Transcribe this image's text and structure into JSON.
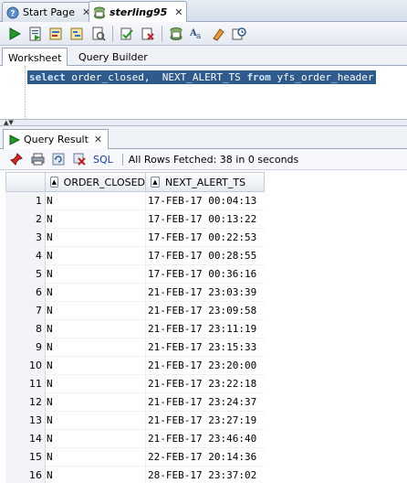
{
  "tabs": [
    {
      "label": "Start Page",
      "icon": "help-icon",
      "active": false
    },
    {
      "label": "sterling95",
      "icon": "sql-worksheet-icon",
      "active": true
    }
  ],
  "subtabs": [
    "Worksheet",
    "Query Builder"
  ],
  "editor": {
    "sql_keyword_select": "select",
    "sql_cols": " order_closed,  NEXT_ALERT_TS ",
    "sql_keyword_from": "from",
    "sql_table": " yfs_order_header"
  },
  "result": {
    "tab_label": "Query Result",
    "sql_label": "SQL",
    "status": "All Rows Fetched: 38 in 0 seconds"
  },
  "grid": {
    "columns": [
      "ORDER_CLOSED",
      "NEXT_ALERT_TS"
    ],
    "rows": [
      [
        "1",
        "N",
        "17-FEB-17 00:04:13"
      ],
      [
        "2",
        "N",
        "17-FEB-17 00:13:22"
      ],
      [
        "3",
        "N",
        "17-FEB-17 00:22:53"
      ],
      [
        "4",
        "N",
        "17-FEB-17 00:28:55"
      ],
      [
        "5",
        "N",
        "17-FEB-17 00:36:16"
      ],
      [
        "6",
        "N",
        "21-FEB-17 23:03:39"
      ],
      [
        "7",
        "N",
        "21-FEB-17 23:09:58"
      ],
      [
        "8",
        "N",
        "21-FEB-17 23:11:19"
      ],
      [
        "9",
        "N",
        "21-FEB-17 23:15:33"
      ],
      [
        "10",
        "N",
        "21-FEB-17 23:20:00"
      ],
      [
        "11",
        "N",
        "21-FEB-17 23:22:18"
      ],
      [
        "12",
        "N",
        "21-FEB-17 23:24:37"
      ],
      [
        "13",
        "N",
        "21-FEB-17 23:27:19"
      ],
      [
        "14",
        "N",
        "21-FEB-17 23:46:40"
      ],
      [
        "15",
        "N",
        "22-FEB-17 20:14:36"
      ],
      [
        "16",
        "N",
        "28-FEB-17 23:37:02"
      ]
    ]
  },
  "colors": {
    "selection": "#2f5a8c",
    "run_green": "#1f9a2a"
  }
}
